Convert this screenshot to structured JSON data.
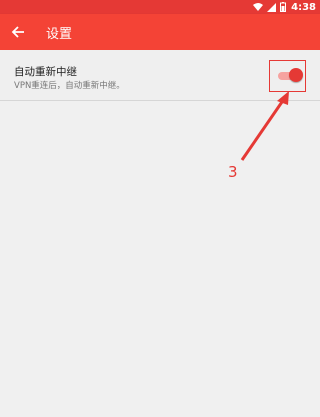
{
  "status_bar": {
    "time": "4:38"
  },
  "app_bar": {
    "title": "设置"
  },
  "setting": {
    "title": "自动重新中继",
    "subtitle": "VPN重连后，自动重新中继。",
    "enabled": true
  },
  "annotation": {
    "number": "3",
    "color": "#e53935"
  },
  "colors": {
    "accent": "#f44336",
    "status_bar": "#e53935"
  }
}
